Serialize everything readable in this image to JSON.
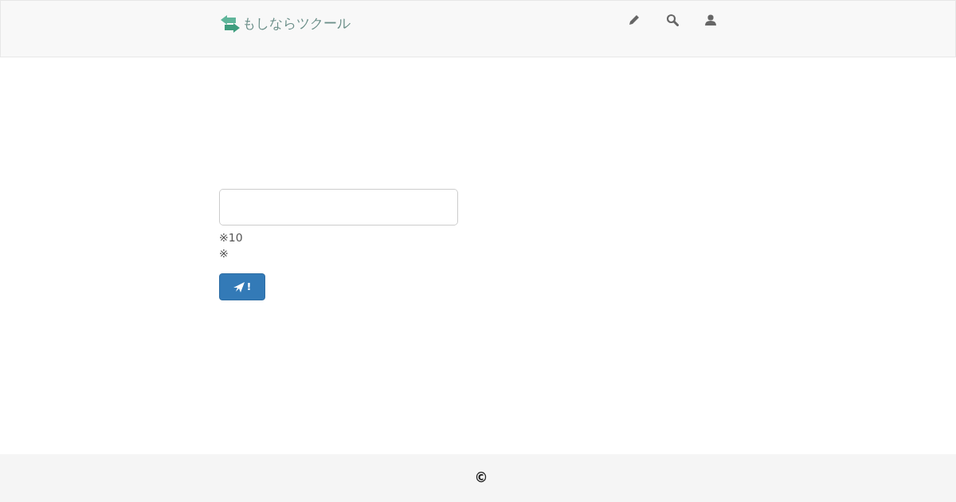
{
  "navbar": {
    "brand": "もしならツクール"
  },
  "form": {
    "hints": [
      "※10",
      "※"
    ],
    "submit_button": {
      "label": "!"
    }
  },
  "footer": {
    "copyright": "©"
  }
}
